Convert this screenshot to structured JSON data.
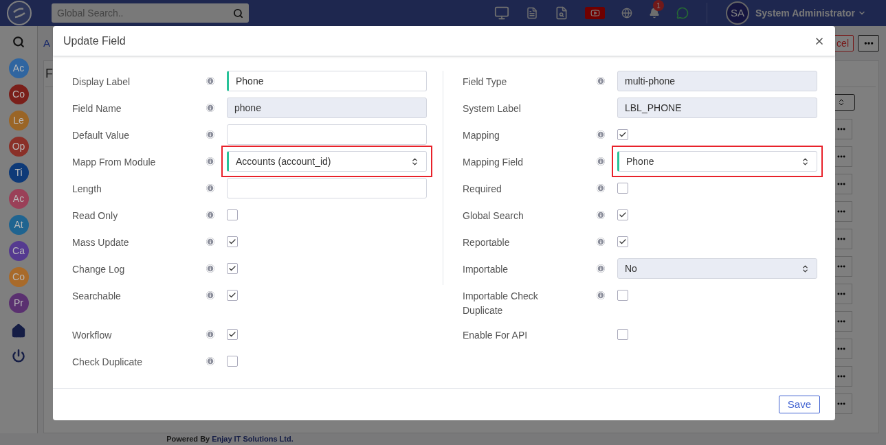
{
  "header": {
    "search_placeholder": "Global Search..",
    "notification_count": "1",
    "user_initials": "SA",
    "user_name": "System Administrator"
  },
  "sidebar": {
    "items": [
      {
        "label": "Ac",
        "color": "#2f65a0"
      },
      {
        "label": "Co",
        "color": "#7a1f1a"
      },
      {
        "label": "Le",
        "color": "#9a6526"
      },
      {
        "label": "Op",
        "color": "#8a3028"
      },
      {
        "label": "Ti",
        "color": "#0e3a78"
      },
      {
        "label": "Ac",
        "color": "#9a4058"
      },
      {
        "label": "At",
        "color": "#1f6490"
      },
      {
        "label": "Ca",
        "color": "#553a90"
      },
      {
        "label": "Co",
        "color": "#a86a2a"
      },
      {
        "label": "Pr",
        "color": "#5a3070"
      }
    ]
  },
  "background": {
    "tab_fragment": "A",
    "heading_fragment": "F",
    "cancel_fragment": "cel"
  },
  "modal": {
    "title": "Update Field",
    "left_fields": [
      {
        "label": "Display Label",
        "info": true,
        "kind": "input",
        "value": "Phone",
        "required": true
      },
      {
        "label": "Field Name",
        "info": true,
        "kind": "readonly",
        "value": "phone",
        "required": false
      },
      {
        "label": "Default Value",
        "info": true,
        "kind": "input",
        "required": false
      },
      {
        "label": "Mapp From Module",
        "info": true,
        "kind": "select",
        "value": "Accounts (account_id)",
        "required": true,
        "highlighted": true,
        "readonly": false
      },
      {
        "label": "Length",
        "info": true,
        "kind": "input",
        "required": false
      },
      {
        "label": "Read Only",
        "info": true,
        "kind": "checkbox",
        "checked": false
      },
      {
        "label": "Mass Update",
        "info": true,
        "kind": "checkbox",
        "checked": true
      },
      {
        "label": "Change Log",
        "info": true,
        "kind": "checkbox",
        "checked": true
      },
      {
        "label": "Searchable",
        "info": true,
        "kind": "checkbox",
        "checked": true
      },
      {
        "label": "Workflow",
        "info": true,
        "kind": "checkbox",
        "checked": true
      },
      {
        "label": "Check Duplicate",
        "info": true,
        "kind": "checkbox",
        "checked": false
      }
    ],
    "right_fields": [
      {
        "label": "Field Type",
        "info": true,
        "kind": "readonly",
        "value": "multi-phone",
        "required": false
      },
      {
        "label": "System Label",
        "info": false,
        "kind": "readonly",
        "value": "LBL_PHONE",
        "required": false
      },
      {
        "label": "Mapping",
        "info": true,
        "kind": "checkbox",
        "checked": true
      },
      {
        "label": "Mapping Field",
        "info": true,
        "kind": "select",
        "value": "Phone",
        "required": true,
        "highlighted": true,
        "readonly": false
      },
      {
        "label": "Required",
        "info": true,
        "kind": "checkbox",
        "checked": false
      },
      {
        "label": "Global Search",
        "info": true,
        "kind": "checkbox",
        "checked": true
      },
      {
        "label": "Reportable",
        "info": true,
        "kind": "checkbox",
        "checked": true
      },
      {
        "label": "Importable",
        "info": true,
        "kind": "select",
        "value": "No",
        "required": false,
        "highlighted": false,
        "readonly": true
      },
      {
        "label": "Importable Check Duplicate",
        "info": true,
        "kind": "checkbox",
        "checked": false
      },
      {
        "label": "Enable For API",
        "info": false,
        "kind": "checkbox",
        "checked": false
      }
    ],
    "save_label": "Save"
  },
  "footer": {
    "text": "Powered By",
    "link": "Enjay IT Solutions Ltd."
  }
}
